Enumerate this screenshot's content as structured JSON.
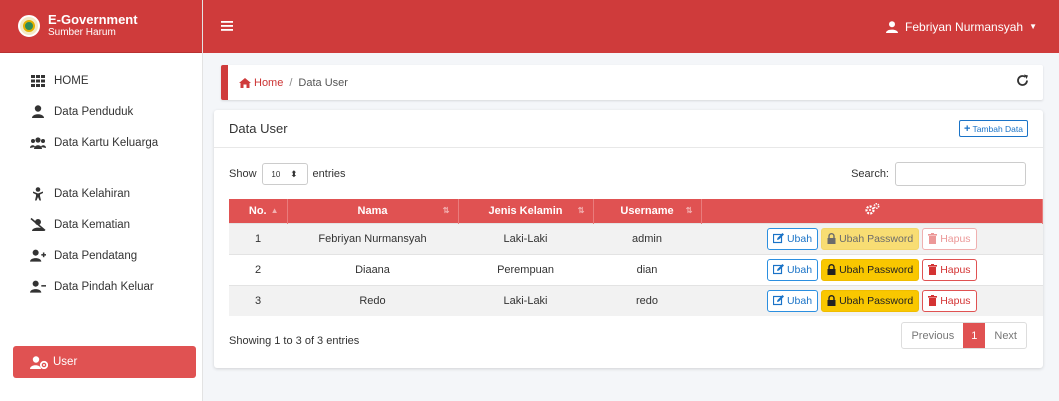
{
  "brand": {
    "title": "E-Government",
    "subtitle": "Sumber Harum"
  },
  "sidebar": {
    "items": [
      {
        "label": "HOME",
        "icon": "grid-icon"
      },
      {
        "label": "Data Penduduk",
        "icon": "user-icon"
      },
      {
        "label": "Data Kartu Keluarga",
        "icon": "users-icon"
      },
      {
        "label": "Data Kelahiran",
        "icon": "child-icon"
      },
      {
        "label": "Data Kematian",
        "icon": "user-slash-icon"
      },
      {
        "label": "Data Pendatang",
        "icon": "user-plus-icon"
      },
      {
        "label": "Data Pindah Keluar",
        "icon": "user-minus-icon"
      }
    ],
    "active": {
      "label": "User",
      "icon": "users-cog-icon"
    }
  },
  "topbar": {
    "menu_icon": "hamburger-icon",
    "username": "Febriyan Nurmansyah"
  },
  "breadcrumb": {
    "home": "Home",
    "separator": "/",
    "current": "Data User"
  },
  "card": {
    "title": "Data User",
    "add_button": "Tambah Data"
  },
  "controls": {
    "show_label": "Show",
    "entries_value": "10",
    "entries_label": "entries",
    "search_label": "Search:"
  },
  "table": {
    "headers": [
      "No.",
      "Nama",
      "Jenis Kelamin",
      "Username"
    ],
    "rows": [
      {
        "no": "1",
        "nama": "Febriyan Nurmansyah",
        "jk": "Laki-Laki",
        "username": "admin",
        "actions_enabled": false
      },
      {
        "no": "2",
        "nama": "Diaana",
        "jk": "Perempuan",
        "username": "dian",
        "actions_enabled": true
      },
      {
        "no": "3",
        "nama": "Redo",
        "jk": "Laki-Laki",
        "username": "redo",
        "actions_enabled": true
      }
    ],
    "action_labels": {
      "edit": "Ubah",
      "password": "Ubah Password",
      "delete": "Hapus"
    }
  },
  "footer": {
    "info": "Showing 1 to 3 of 3 entries"
  },
  "pagination": {
    "previous": "Previous",
    "current": "1",
    "next": "Next"
  },
  "colors": {
    "primary": "#cf3b3b",
    "accent": "#e05252",
    "link": "#1a73c7",
    "warning": "#f9c700"
  }
}
